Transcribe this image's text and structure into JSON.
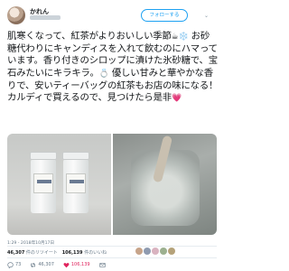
{
  "header": {
    "username": "かれん",
    "follow_label": "フォローする",
    "caret": "⌄"
  },
  "tweet": {
    "line_1": "肌寒くなって、紅茶がよりおいしい季節",
    "line_1_emoji_a": "☕",
    "line_1_emoji_b": "❄️",
    "text_after_emoji": " お砂糖代わりにキャンディスを入れて飲むのにハマっています。香り付きのシロップに漬けた氷砂糖で、宝石みたいにキラキラ。",
    "diamond_emoji": "💍",
    "text_after_diamond": " 優しい甘みと華やかな香りで、安いティーバッグの紅茶もお店の味になる！カルディで買えるので、見つけたら是非",
    "heart_emoji": "💗"
  },
  "timestamp": "1:29 - 2018年10月17日",
  "stats": {
    "retweets_count": "46,307",
    "retweets_label": "件のリツイート",
    "likes_count": "106,139",
    "likes_label": "件のいいね"
  },
  "actions": {
    "reply_count": "73",
    "retweet_count": "46,307",
    "like_count": "106,139"
  },
  "colors": {
    "accent": "#1da1f2",
    "like": "#e0245e",
    "muted": "#657786"
  }
}
